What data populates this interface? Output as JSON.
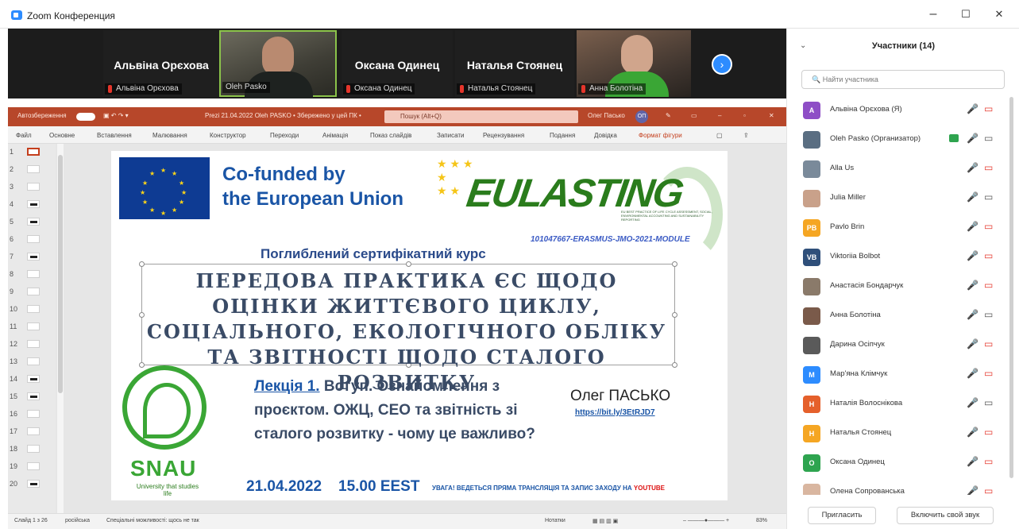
{
  "window": {
    "title": "Zoom Конференция",
    "minimize": "–",
    "maximize": "☐",
    "close": "✕"
  },
  "participants_strip": [
    {
      "big_name": "Альвіна Орєхова",
      "tag": "Альвіна Орєхова",
      "video": false
    },
    {
      "big_name": "",
      "tag": "Oleh Pasko",
      "video": true
    },
    {
      "big_name": "Оксана Одинец",
      "tag": "Оксана Одинец",
      "video": false
    },
    {
      "big_name": "Наталья Стоянец",
      "tag": "Наталья Стоянец",
      "video": false
    },
    {
      "big_name": "",
      "tag": "Анна Болотіна",
      "video": true
    }
  ],
  "powerpoint": {
    "autosave": "Автозбереження",
    "file_title": "Prezi 21.04.2022 Oleh PASKO • Збережено у цей ПК •",
    "search": "Пошук (Alt+Q)",
    "user": "Олег Пасько",
    "user_initials": "ОП",
    "ribbon_tabs": [
      "Файл",
      "Основне",
      "Вставлення",
      "Малювання",
      "Конструктор",
      "Переходи",
      "Анімація",
      "Показ слайдів",
      "Записати",
      "Рецензування",
      "Подання",
      "Довідка",
      "Формат фігури"
    ],
    "thumb_numbers": [
      "1",
      "2",
      "3",
      "4",
      "5",
      "6",
      "7",
      "8",
      "9",
      "10",
      "11",
      "12",
      "13",
      "14",
      "15",
      "16",
      "17",
      "18",
      "19",
      "20"
    ],
    "status_slide": "Слайд 1 з 26",
    "status_lang": "російська",
    "status_access": "Спеціальні можливості: щось не так",
    "status_notes": "Нотатки",
    "status_zoom": "83%"
  },
  "slide": {
    "cofunded_line1": "Co-funded by",
    "cofunded_line2": "the European Union",
    "eu_logo": "EULASTING",
    "eu_small": "EU BEST PRACTICE OF LIFE CYCLE ASSESSMENT, SOCIAL, ENVIRONMENTAL ACCOUNTING AND SUSTAINABILITY REPORTING",
    "project_code": "101047667-ERASMUS-JMO-2021-MODULE",
    "course": "Поглиблений сертифікатний курс",
    "title": "ПЕРЕДОВА ПРАКТИКА ЄС ЩОДО ОЦІНКИ ЖИТТЄВОГО ЦИКЛУ, СОЦІАЛЬНОГО, ЕКОЛОГІЧНОГО ОБЛІКУ ТА ЗВІТНОСТІ ЩОДО СТАЛОГО РОЗВИТКУ",
    "lecture_no": "Лекція 1.",
    "lecture_text": "Вступ. Ознайомлення з проєктом. ОЖЦ, СЕО та звітність зі сталого розвитку - чому це важливо?",
    "author": "Олег ПАСЬКО",
    "link": "https://bit.ly/3EtRJD7",
    "snau": "SNAU",
    "snau_sub": "University that studies life",
    "date": "21.04.2022",
    "time": "15.00 EEST",
    "notice": "УВАГА! ВЕДЕТЬСЯ ПРЯМА ТРАНСЛЯЦІЯ ТА ЗАПИС ЗАХОДУ НА",
    "notice_yt": "YOUTUBE"
  },
  "panel": {
    "title": "Участники (14)",
    "search_placeholder": "Найти участника",
    "invite": "Пригласить",
    "unmute": "Включить свой звук",
    "participants": [
      {
        "initials": "A",
        "color": "#8e4ec6",
        "name": "Альвіна Орєхова (Я)",
        "cam": "off"
      },
      {
        "initials": "",
        "color": "#5a6e82",
        "name": "Oleh Pasko (Организатор)",
        "cam": "on-video"
      },
      {
        "initials": "",
        "color": "#7a8a9a",
        "name": "Alla Us",
        "cam": "off"
      },
      {
        "initials": "",
        "color": "#c9a18a",
        "name": "Julia Miller",
        "cam": "on"
      },
      {
        "initials": "PB",
        "color": "#f5a623",
        "name": "Pavlo Brin",
        "cam": "off"
      },
      {
        "initials": "VB",
        "color": "#2f4f7a",
        "name": "Viktoriia Bolbot",
        "cam": "off"
      },
      {
        "initials": "",
        "color": "#8a7a6a",
        "name": "Анастасія Бондарчук",
        "cam": "off"
      },
      {
        "initials": "",
        "color": "#7a5a4a",
        "name": "Анна Болотіна",
        "cam": "on"
      },
      {
        "initials": "",
        "color": "#5a5a5a",
        "name": "Дарина Осіпчук",
        "cam": "off"
      },
      {
        "initials": "M",
        "color": "#2d8cff",
        "name": "Мар'яна Клімчук",
        "cam": "off"
      },
      {
        "initials": "H",
        "color": "#e5602b",
        "name": "Наталія Волоснікова",
        "cam": "on"
      },
      {
        "initials": "H",
        "color": "#f5a623",
        "name": "Наталья Стоянец",
        "cam": "off"
      },
      {
        "initials": "O",
        "color": "#2ea44f",
        "name": "Оксана Одинец",
        "cam": "off"
      },
      {
        "initials": "",
        "color": "#d9b6a0",
        "name": "Олена Сопрованська",
        "cam": "off"
      }
    ]
  }
}
